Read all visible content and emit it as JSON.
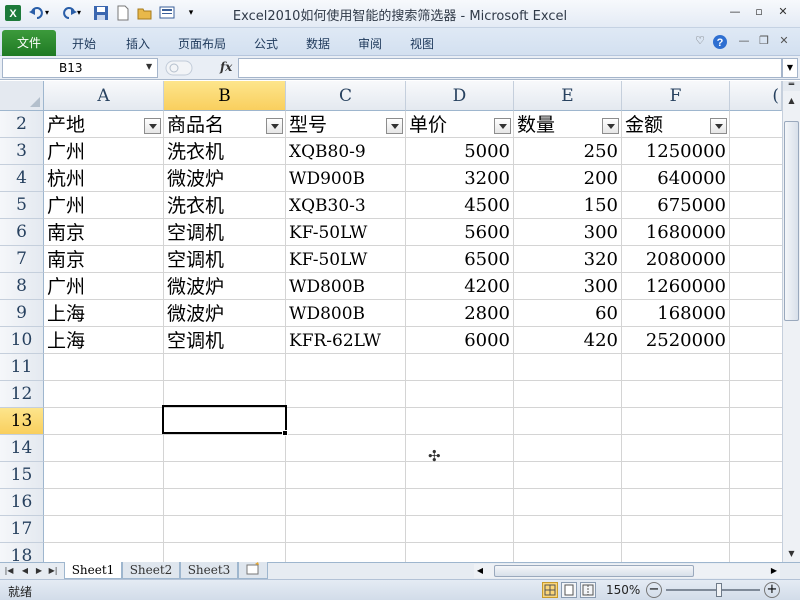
{
  "window": {
    "title": "Excel2010如何使用智能的搜索筛选器 - Microsoft Excel",
    "controls": [
      "—",
      "▫",
      "✕"
    ]
  },
  "quick_access": [
    "excel-logo-icon",
    "undo-icon",
    "redo-icon",
    "save-icon",
    "new-icon",
    "open-icon",
    "print-preview-icon",
    "customize-qat-icon"
  ],
  "ribbon": {
    "file_tab": "文件",
    "tabs": [
      "开始",
      "插入",
      "页面布局",
      "公式",
      "数据",
      "审阅",
      "视图"
    ],
    "right_icons": [
      "minimize-ribbon-icon",
      "help-icon",
      "minimize-icon",
      "restore-icon",
      "close-icon"
    ]
  },
  "formula_bar": {
    "name_box": "B13",
    "fx": "fx",
    "formula": ""
  },
  "grid": {
    "columns": [
      "A",
      "B",
      "C",
      "D",
      "E",
      "F"
    ],
    "selected_column": "B",
    "rows": [
      "2",
      "3",
      "4",
      "5",
      "6",
      "7",
      "8",
      "9",
      "10",
      "11",
      "12",
      "13",
      "14",
      "15",
      "16",
      "17",
      "18"
    ],
    "selected_row": "13",
    "headers": [
      "产地",
      "商品名",
      "型号",
      "单价",
      "数量",
      "金额"
    ],
    "data": [
      [
        "广州",
        "洗衣机",
        "XQB80-9",
        "5000",
        "250",
        "1250000"
      ],
      [
        "杭州",
        "微波炉",
        "WD900B",
        "3200",
        "200",
        "640000"
      ],
      [
        "广州",
        "洗衣机",
        "XQB30-3",
        "4500",
        "150",
        "675000"
      ],
      [
        "南京",
        "空调机",
        "KF-50LW",
        "5600",
        "300",
        "1680000"
      ],
      [
        "南京",
        "空调机",
        "KF-50LW",
        "6500",
        "320",
        "2080000"
      ],
      [
        "广州",
        "微波炉",
        "WD800B",
        "4200",
        "300",
        "1260000"
      ],
      [
        "上海",
        "微波炉",
        "WD800B",
        "2800",
        "60",
        "168000"
      ],
      [
        "上海",
        "空调机",
        "KFR-62LW",
        "6000",
        "420",
        "2520000"
      ]
    ],
    "partial_column_glyph": "("
  },
  "sheets": {
    "tabs": [
      "Sheet1",
      "Sheet2",
      "Sheet3"
    ],
    "active": "Sheet1"
  },
  "status": {
    "text": "就绪",
    "zoom": "150%",
    "zoom_out": "−",
    "zoom_in": "+"
  }
}
